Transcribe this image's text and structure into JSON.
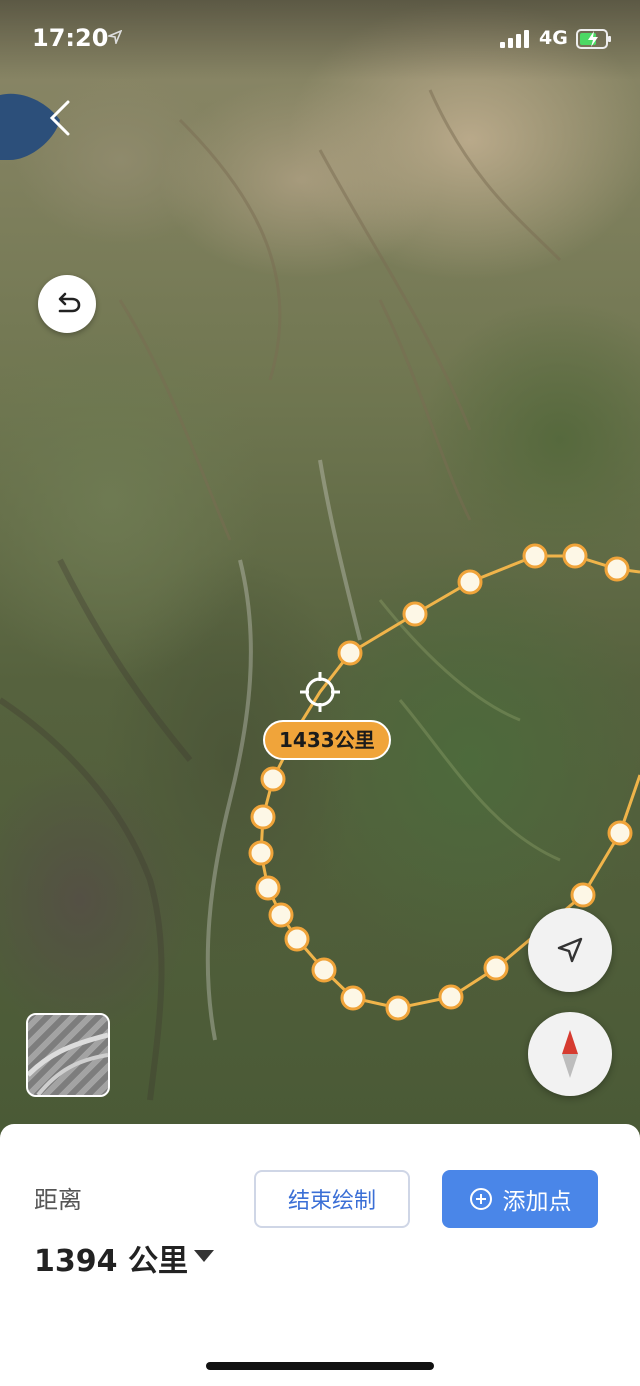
{
  "status_bar": {
    "time": "17:20",
    "network": "4G",
    "icons": [
      "location-arrow-icon",
      "signal-bars-icon",
      "battery-charging-icon"
    ]
  },
  "map": {
    "type": "satellite",
    "tool": "distance-measure",
    "route_label": "1433公里",
    "route_color": "#f0a43a",
    "vertex_fill": "#fdf7e6",
    "controls": [
      "back-chevron-icon",
      "undo-icon",
      "map-layer-icon",
      "navigate-arrow-icon",
      "compass-icon"
    ]
  },
  "panel": {
    "distance_title": "距离",
    "distance_value": "1394 公里",
    "end_button": "结束绘制",
    "add_button": "添加点",
    "accent": "#4a86e8"
  }
}
